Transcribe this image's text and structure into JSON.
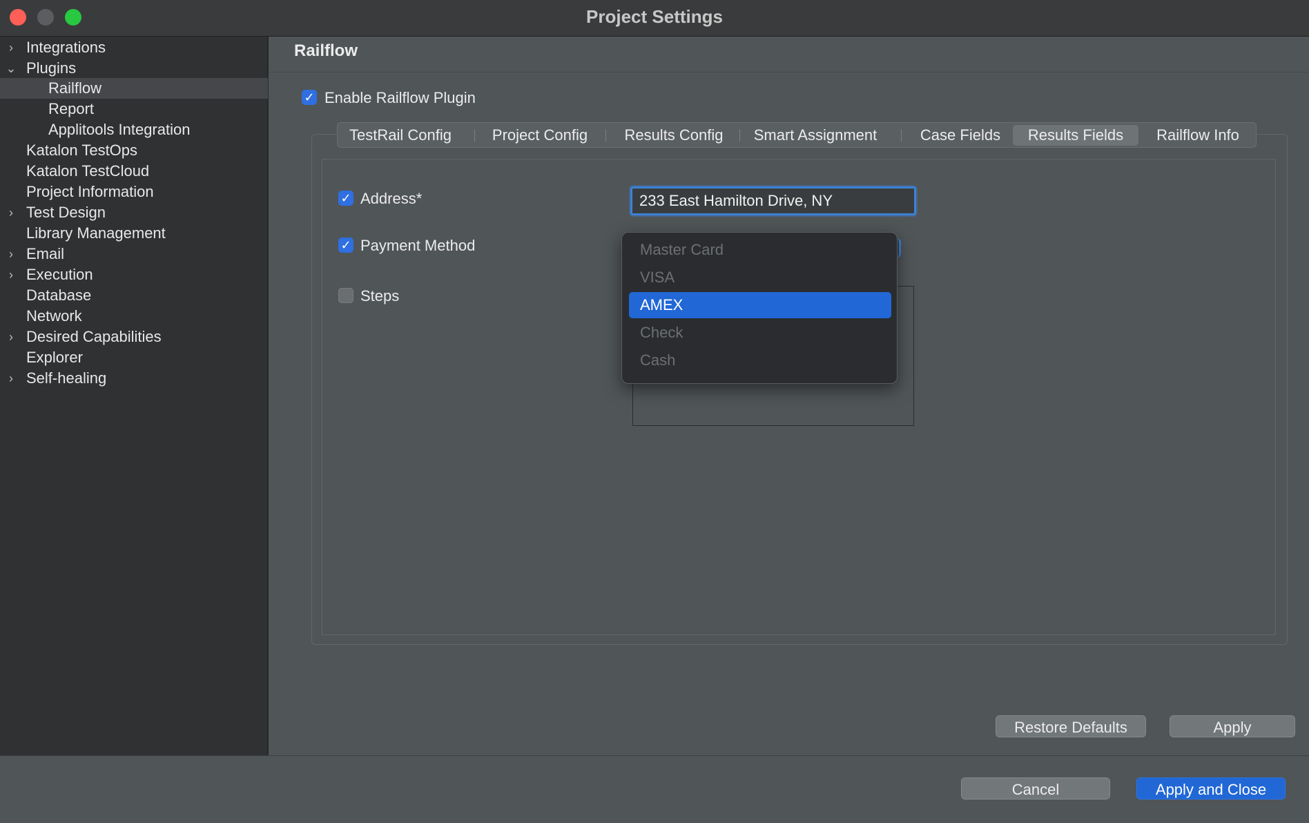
{
  "window": {
    "title": "Project Settings"
  },
  "sidebar": {
    "items": [
      {
        "label": "Integrations",
        "expander": "collapsed"
      },
      {
        "label": "Plugins",
        "expander": "expanded"
      },
      {
        "label": "Railflow",
        "expander": "none",
        "selected": true
      },
      {
        "label": "Report",
        "expander": "none"
      },
      {
        "label": "Applitools Integration",
        "expander": "none"
      },
      {
        "label": "Katalon TestOps",
        "expander": "none"
      },
      {
        "label": "Katalon TestCloud",
        "expander": "none"
      },
      {
        "label": "Project Information",
        "expander": "none"
      },
      {
        "label": "Test Design",
        "expander": "collapsed"
      },
      {
        "label": "Library Management",
        "expander": "none"
      },
      {
        "label": "Email",
        "expander": "collapsed"
      },
      {
        "label": "Execution",
        "expander": "collapsed"
      },
      {
        "label": "Database",
        "expander": "none"
      },
      {
        "label": "Network",
        "expander": "none"
      },
      {
        "label": "Desired Capabilities",
        "expander": "collapsed"
      },
      {
        "label": "Explorer",
        "expander": "none"
      },
      {
        "label": "Self-healing",
        "expander": "collapsed"
      }
    ]
  },
  "main": {
    "title": "Railflow",
    "enable_plugin": {
      "label": "Enable Railflow Plugin",
      "checked": true
    },
    "tabs": [
      {
        "label": "TestRail Config"
      },
      {
        "label": "Project Config"
      },
      {
        "label": "Results Config"
      },
      {
        "label": "Smart Assignment"
      },
      {
        "label": "Case Fields"
      },
      {
        "label": "Results Fields",
        "active": true
      },
      {
        "label": "Railflow Info"
      }
    ],
    "fields": {
      "address": {
        "label": "Address*",
        "checked": true,
        "value": "233 East Hamilton Drive, NY"
      },
      "payment_method": {
        "label": "Payment Method",
        "checked": true,
        "selected": "AMEX"
      },
      "steps": {
        "label": "Steps",
        "checked": false
      }
    },
    "payment_options": [
      "Master Card",
      "VISA",
      "AMEX",
      "Check",
      "Cash"
    ]
  },
  "buttons": {
    "restore_defaults": "Restore Defaults",
    "apply": "Apply",
    "cancel": "Cancel",
    "apply_and_close": "Apply and Close"
  },
  "icons": {
    "check": "checkmark-icon",
    "chevron_right": "chevron-right-icon",
    "chevron_down": "chevron-down-icon"
  },
  "colors": {
    "accent": "#2167d6",
    "focus_ring": "#3b82d6"
  }
}
